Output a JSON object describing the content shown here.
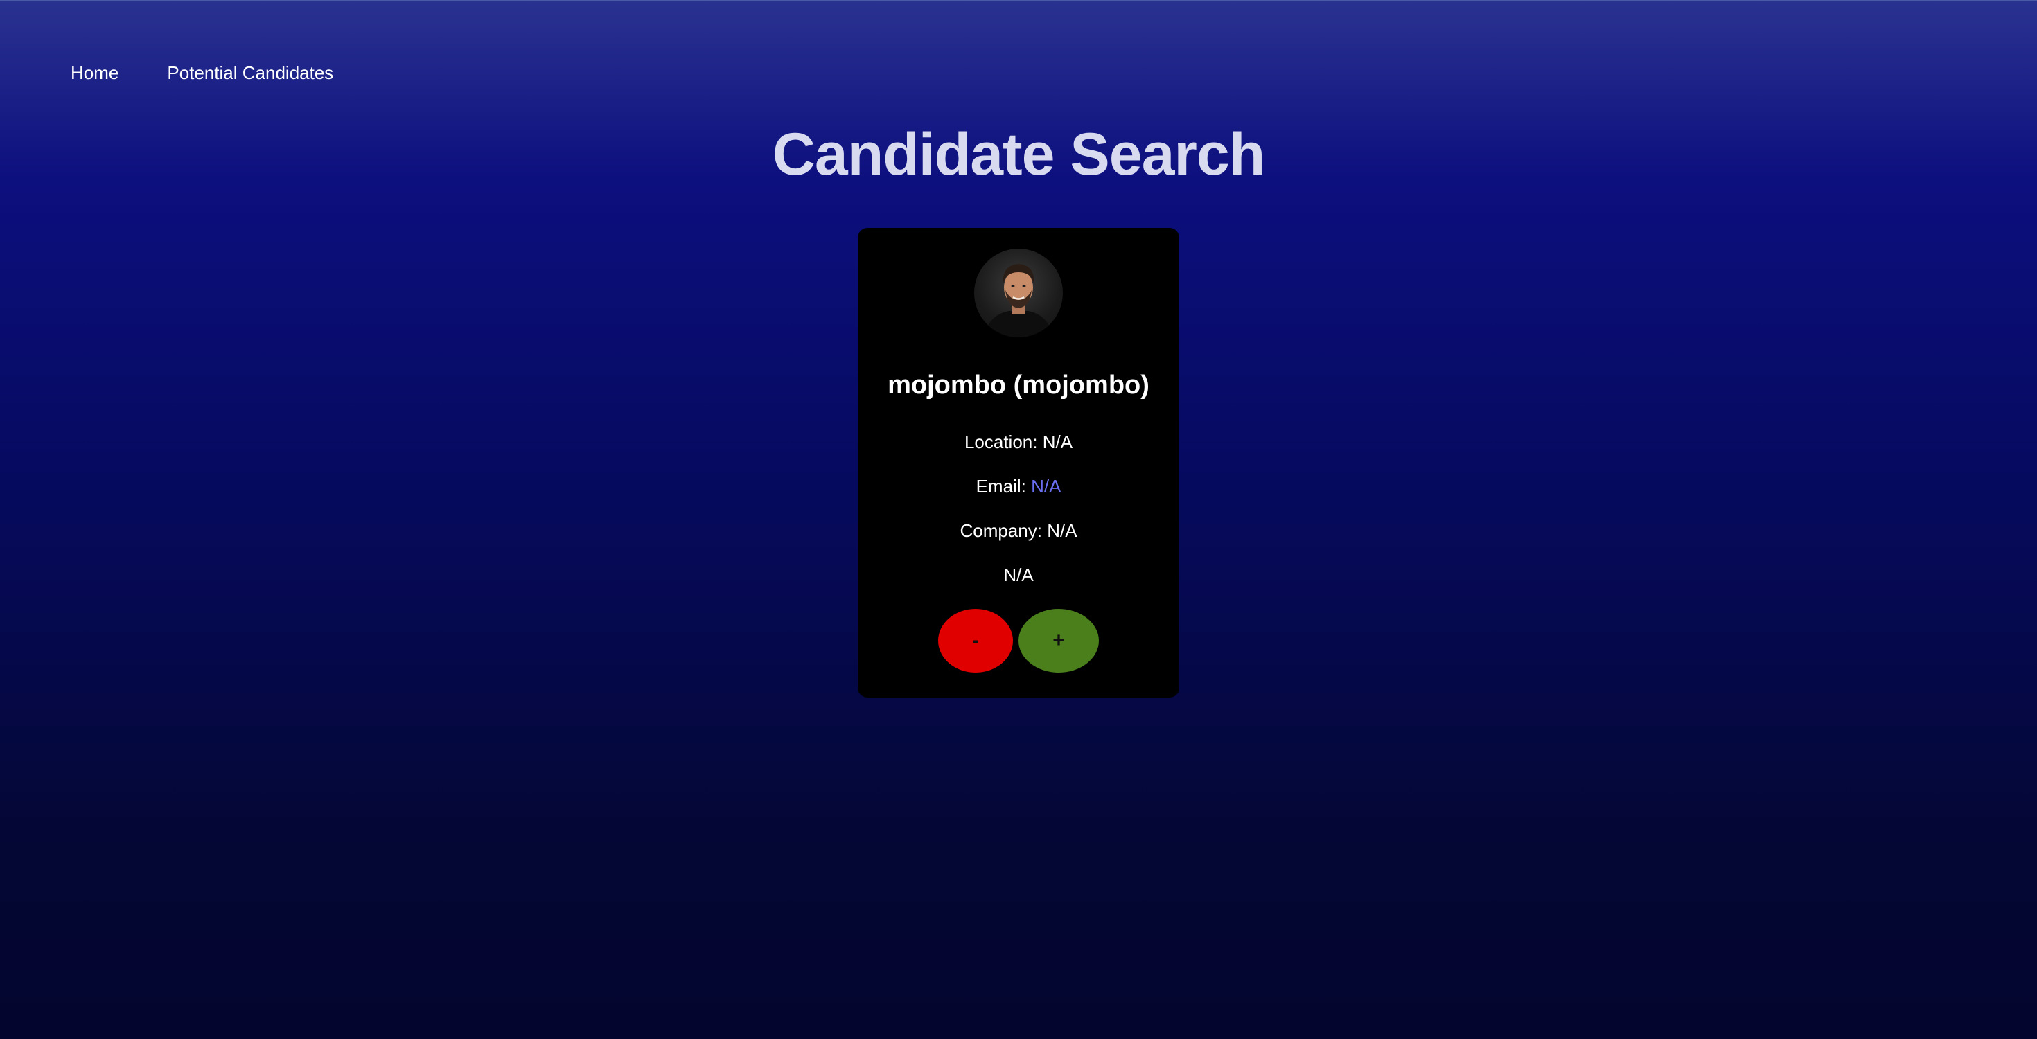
{
  "nav": {
    "home": "Home",
    "potential_candidates": "Potential Candidates"
  },
  "page": {
    "title": "Candidate Search"
  },
  "candidate": {
    "name": "mojombo (mojombo)",
    "location_label": "Location: ",
    "location": "N/A",
    "email_label": "Email: ",
    "email": "N/A",
    "company_label": "Company: ",
    "company": "N/A",
    "bio": "N/A"
  },
  "actions": {
    "reject_label": "-",
    "accept_label": "+"
  },
  "colors": {
    "reject": "#e10000",
    "accept": "#4a7f1c",
    "email_link": "#6a6ff0"
  }
}
